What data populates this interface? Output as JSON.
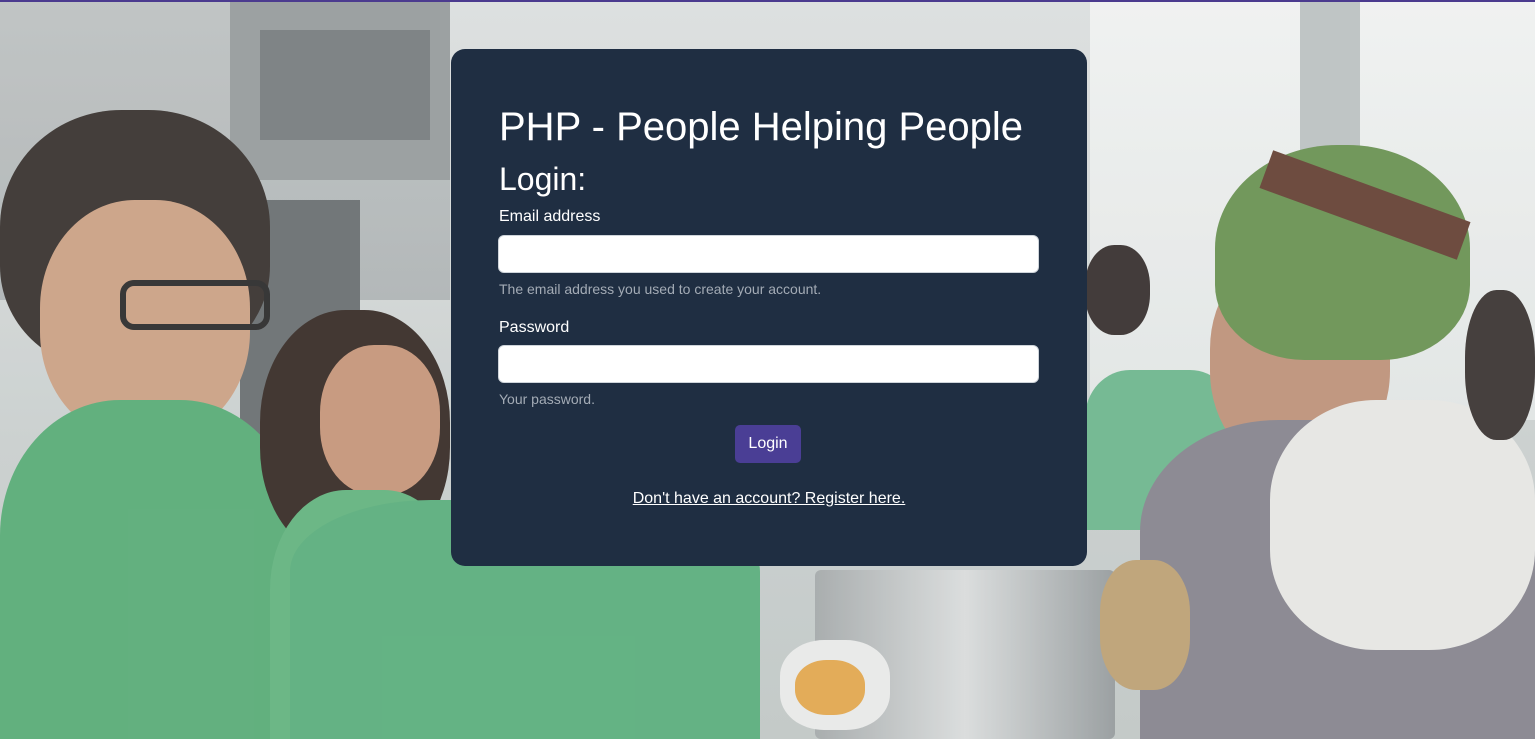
{
  "page": {
    "accent_color": "#4a3e95",
    "card_color": "#1f2e42",
    "background_description_icon": "volunteer-kitchen-photo"
  },
  "login": {
    "title": "PHP - People Helping People",
    "subtitle": "Login:",
    "email": {
      "label": "Email address",
      "value": "",
      "help": "The email address you used to create your account."
    },
    "password": {
      "label": "Password",
      "value": "",
      "help": "Your password."
    },
    "submit_label": "Login",
    "register_link": "Don't have an account? Register here."
  }
}
